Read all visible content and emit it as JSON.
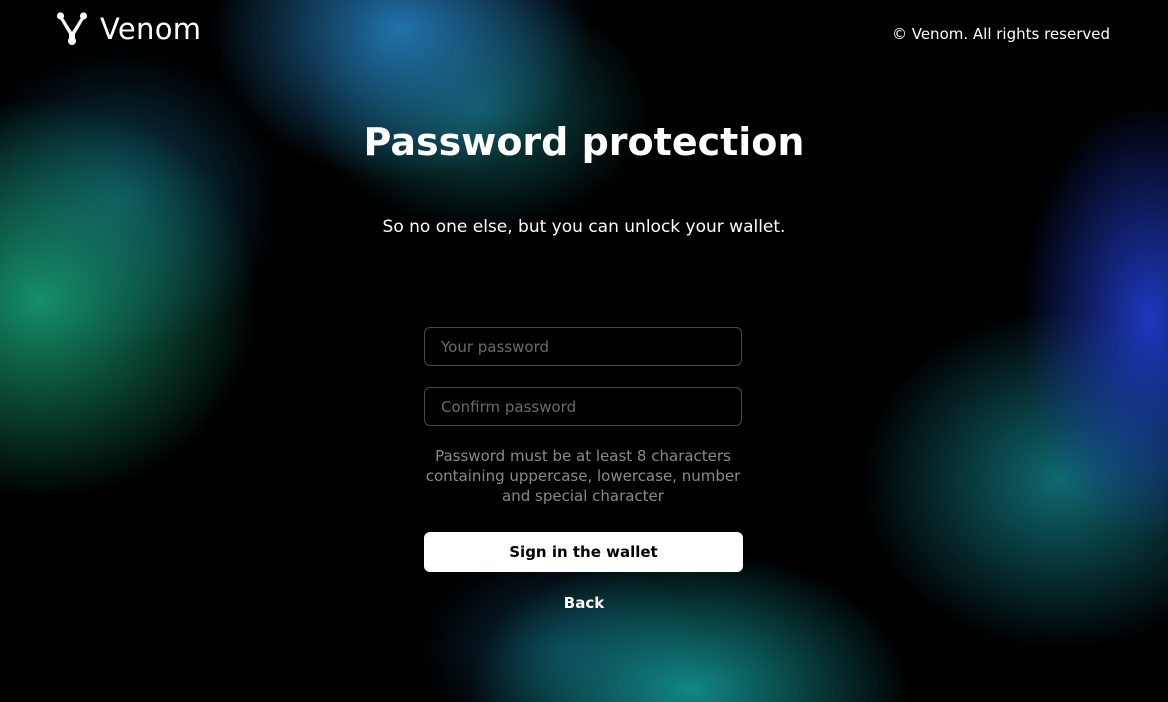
{
  "header": {
    "brand_name": "Venom",
    "logo_icon": "venom-logo-icon",
    "copyright": "© Venom. All rights reserved"
  },
  "main": {
    "title": "Password protection",
    "subtitle": "So no one else, but you can unlock your wallet.",
    "password_field": {
      "placeholder": "Your password",
      "value": ""
    },
    "confirm_field": {
      "placeholder": "Confirm password",
      "value": ""
    },
    "hint_lines": [
      "Password must be at least 8 characters",
      "containing uppercase, lowercase, number",
      "and special character"
    ],
    "signin_label": "Sign in the wallet",
    "back_label": "Back"
  },
  "colors": {
    "background": "#000000",
    "primary_button": "#ffffff",
    "hint_text": "#8a8a8a",
    "field_border": "#4a4a4a"
  }
}
